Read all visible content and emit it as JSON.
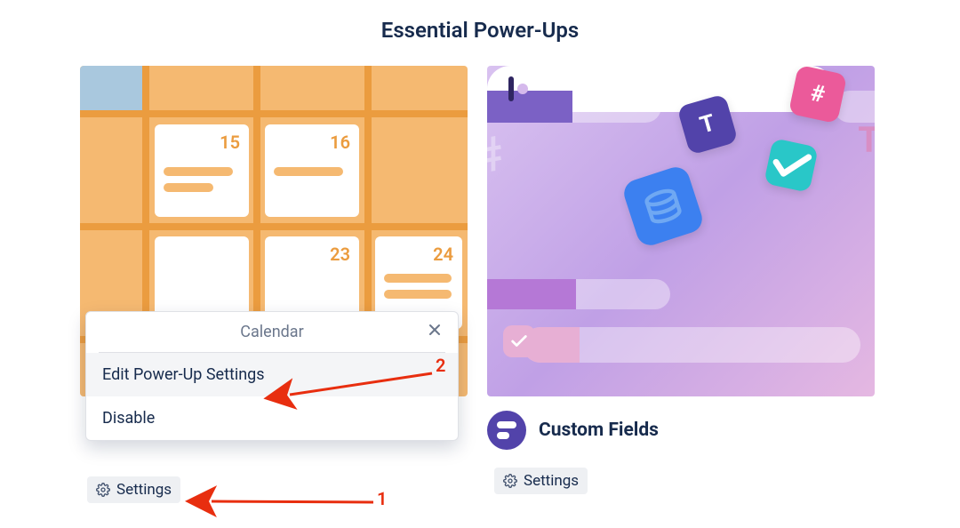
{
  "title": "Essential Power-Ups",
  "cards": {
    "calendar": {
      "days": {
        "d15": "15",
        "d16": "16",
        "d23": "23",
        "d24": "24"
      },
      "settings_label": "Settings",
      "popover": {
        "title": "Calendar",
        "edit": "Edit Power-Up Settings",
        "disable": "Disable"
      }
    },
    "customFields": {
      "title": "Custom Fields",
      "settings_label": "Settings",
      "glyphs": {
        "hash": "#",
        "T": "T",
        "hash_outline": "#",
        "T_outline": "T"
      }
    }
  },
  "annotations": {
    "one": "1",
    "two": "2"
  }
}
